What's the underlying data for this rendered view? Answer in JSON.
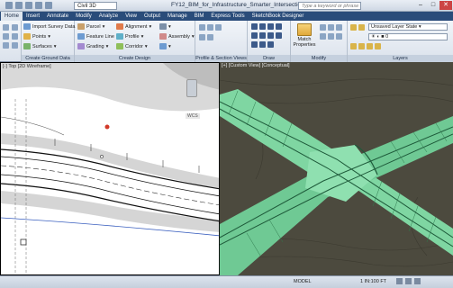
{
  "titlebar": {
    "workspace": "Civil 3D",
    "document_title": "FY12_BIM_for_Infrastructure_Smarter_Intersection.dwg",
    "search_placeholder": "Type a keyword or phrase"
  },
  "tabs": [
    "Home",
    "Insert",
    "Annotate",
    "Modify",
    "Analyze",
    "View",
    "Output",
    "Manage",
    "BIM",
    "Express Tools",
    "SketchBook Designer"
  ],
  "active_tab": "Home",
  "ribbon": {
    "ground_data": {
      "items": [
        "Import Survey Data",
        "Points",
        "Surfaces"
      ],
      "title": "Create Ground Data"
    },
    "design": {
      "items": [
        "Parcel",
        "Feature Line",
        "Grading",
        "Alignment",
        "Profile",
        "Corridor",
        "Assembly"
      ],
      "title": "Create Design"
    },
    "profile_section_title": "Profile & Section Views",
    "draw_title": "Draw",
    "modify": {
      "match_label": "Match",
      "properties_label": "Properties",
      "title": "Modify"
    },
    "layers": {
      "layer_state": "Unsaved Layer State",
      "current_layer": "0",
      "title": "Layers"
    }
  },
  "viewports": {
    "left_label": "[-] Top [2D Wireframe]",
    "compass_label": "WCS",
    "right_label": "[+] [Custom View] [Conceptual]"
  },
  "statusbar": {
    "model": "MODEL",
    "scale": "1 IN:100 FT"
  },
  "colors": {
    "tab_bar": "#2a4c7a",
    "terrain": "#4c4a3e",
    "road_green": "#7fd6a2",
    "road_dark": "#1e5a3a"
  }
}
